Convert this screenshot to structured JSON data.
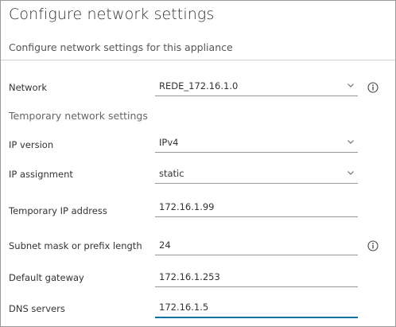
{
  "header": {
    "title": "Configure network settings",
    "subtitle": "Configure network settings for this appliance"
  },
  "form": {
    "network": {
      "label": "Network",
      "value": "REDE_172.16.1.0",
      "icon": "chevron-down-icon",
      "info_icon": "info-icon"
    },
    "temporary_section": "Temporary network settings",
    "ip_version": {
      "label": "IP version",
      "value": "IPv4",
      "icon": "chevron-down-icon"
    },
    "ip_assignment": {
      "label": "IP assignment",
      "value": "static",
      "icon": "chevron-down-icon"
    },
    "temp_ip": {
      "label": "Temporary IP address",
      "value": "172.16.1.99"
    },
    "subnet": {
      "label": "Subnet mask or prefix length",
      "value": "24",
      "info_icon": "info-icon"
    },
    "gateway": {
      "label": "Default gateway",
      "value": "172.16.1.253"
    },
    "dns": {
      "label": "DNS servers",
      "value": "172.16.1.5"
    }
  },
  "colors": {
    "focus_underline": "#0072a3",
    "border": "#9a9a9a"
  }
}
